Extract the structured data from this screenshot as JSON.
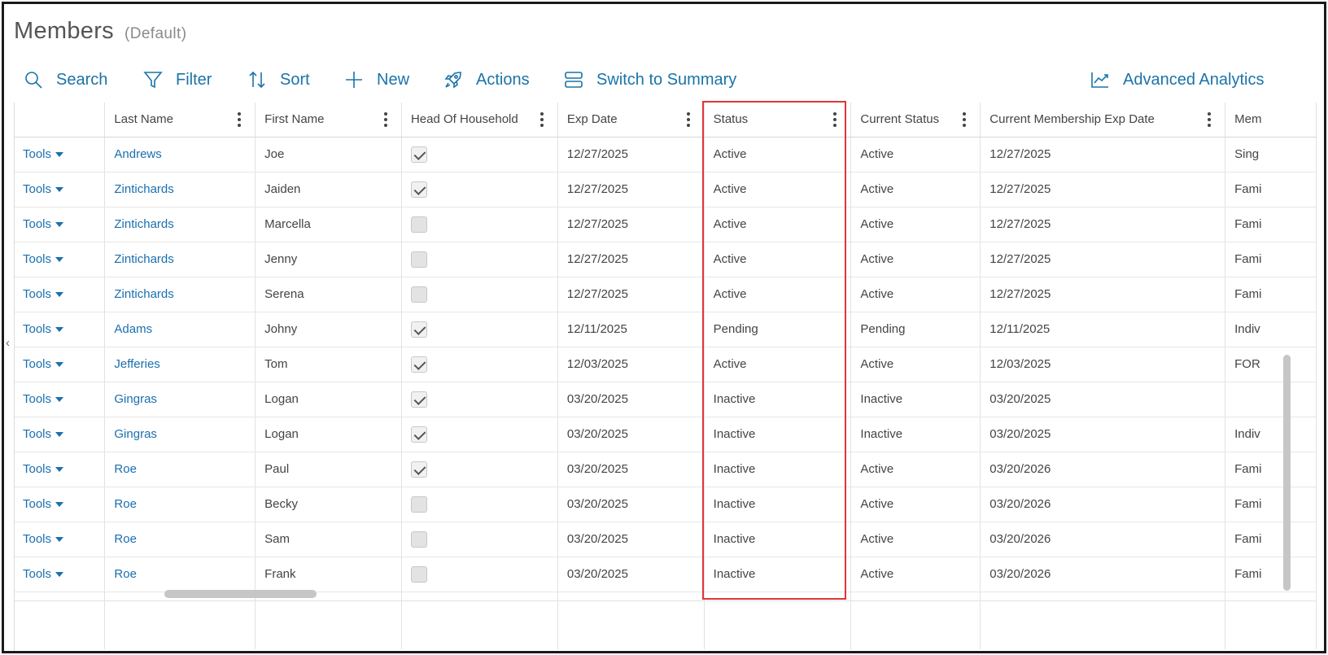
{
  "page": {
    "title": "Members",
    "subtitle": "(Default)"
  },
  "toolbar": {
    "search": "Search",
    "filter": "Filter",
    "sort": "Sort",
    "new": "New",
    "actions": "Actions",
    "switch": "Switch to Summary",
    "analytics": "Advanced Analytics"
  },
  "grid": {
    "columns": [
      "",
      "Last Name",
      "First Name",
      "Head Of Household",
      "Exp Date",
      "Status",
      "Current Status",
      "Current Membership Exp Date",
      "Mem"
    ],
    "tools_label": "Tools",
    "rows": [
      {
        "last": "Andrews",
        "first": "Joe",
        "hoh": true,
        "exp": "12/27/2025",
        "status": "Active",
        "current": "Active",
        "cur_exp": "12/27/2025",
        "mem": "Sing"
      },
      {
        "last": "Zintichards",
        "first": "Jaiden",
        "hoh": true,
        "exp": "12/27/2025",
        "status": "Active",
        "current": "Active",
        "cur_exp": "12/27/2025",
        "mem": "Fami"
      },
      {
        "last": "Zintichards",
        "first": "Marcella",
        "hoh": false,
        "exp": "12/27/2025",
        "status": "Active",
        "current": "Active",
        "cur_exp": "12/27/2025",
        "mem": "Fami"
      },
      {
        "last": "Zintichards",
        "first": "Jenny",
        "hoh": false,
        "exp": "12/27/2025",
        "status": "Active",
        "current": "Active",
        "cur_exp": "12/27/2025",
        "mem": "Fami"
      },
      {
        "last": "Zintichards",
        "first": "Serena",
        "hoh": false,
        "exp": "12/27/2025",
        "status": "Active",
        "current": "Active",
        "cur_exp": "12/27/2025",
        "mem": "Fami"
      },
      {
        "last": "Adams",
        "first": "Johny",
        "hoh": true,
        "exp": "12/11/2025",
        "status": "Pending",
        "current": "Pending",
        "cur_exp": "12/11/2025",
        "mem": "Indiv"
      },
      {
        "last": "Jefferies",
        "first": "Tom",
        "hoh": true,
        "exp": "12/03/2025",
        "status": "Active",
        "current": "Active",
        "cur_exp": "12/03/2025",
        "mem": "FOR"
      },
      {
        "last": "Gingras",
        "first": "Logan",
        "hoh": true,
        "exp": "03/20/2025",
        "status": "Inactive",
        "current": "Inactive",
        "cur_exp": "03/20/2025",
        "mem": ""
      },
      {
        "last": "Gingras",
        "first": "Logan",
        "hoh": true,
        "exp": "03/20/2025",
        "status": "Inactive",
        "current": "Inactive",
        "cur_exp": "03/20/2025",
        "mem": "Indiv"
      },
      {
        "last": "Roe",
        "first": "Paul",
        "hoh": true,
        "exp": "03/20/2025",
        "status": "Inactive",
        "current": "Active",
        "cur_exp": "03/20/2026",
        "mem": "Fami"
      },
      {
        "last": "Roe",
        "first": "Becky",
        "hoh": false,
        "exp": "03/20/2025",
        "status": "Inactive",
        "current": "Active",
        "cur_exp": "03/20/2026",
        "mem": "Fami"
      },
      {
        "last": "Roe",
        "first": "Sam",
        "hoh": false,
        "exp": "03/20/2025",
        "status": "Inactive",
        "current": "Active",
        "cur_exp": "03/20/2026",
        "mem": "Fami"
      },
      {
        "last": "Roe",
        "first": "Frank",
        "hoh": false,
        "exp": "03/20/2025",
        "status": "Inactive",
        "current": "Active",
        "cur_exp": "03/20/2026",
        "mem": "Fami"
      }
    ]
  },
  "colors": {
    "link": "#1a6fae",
    "toolbar": "#1a73a8",
    "highlight": "#e0353b"
  },
  "icons": [
    "search-icon",
    "filter-icon",
    "sort-icon",
    "plus-icon",
    "rocket-icon",
    "switch-view-icon",
    "analytics-chart-icon",
    "kebab-menu-icon",
    "caret-down-icon",
    "checkbox-icon"
  ]
}
